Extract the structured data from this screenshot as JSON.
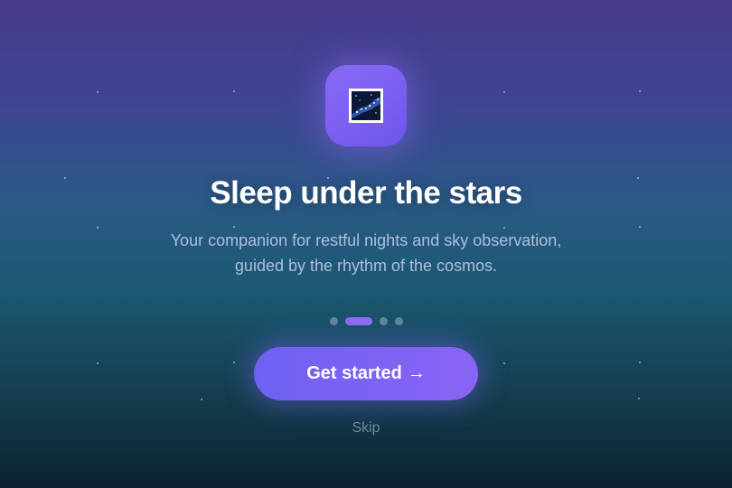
{
  "onboarding": {
    "title": "Sleep under the stars",
    "subtitle_line1": "Your companion for restful nights and sky observation,",
    "subtitle_line2": "guided by the rhythm of the cosmos.",
    "pager": {
      "total": 4,
      "current": 2
    },
    "cta_label": "Get started",
    "cta_arrow": "→",
    "skip_label": "Skip",
    "icon": "night-sky-icon"
  },
  "colors": {
    "accent": "#7b64f4",
    "background_top": "#473a8c",
    "background_bottom": "#0c2230",
    "text_primary": "#ffffff"
  }
}
